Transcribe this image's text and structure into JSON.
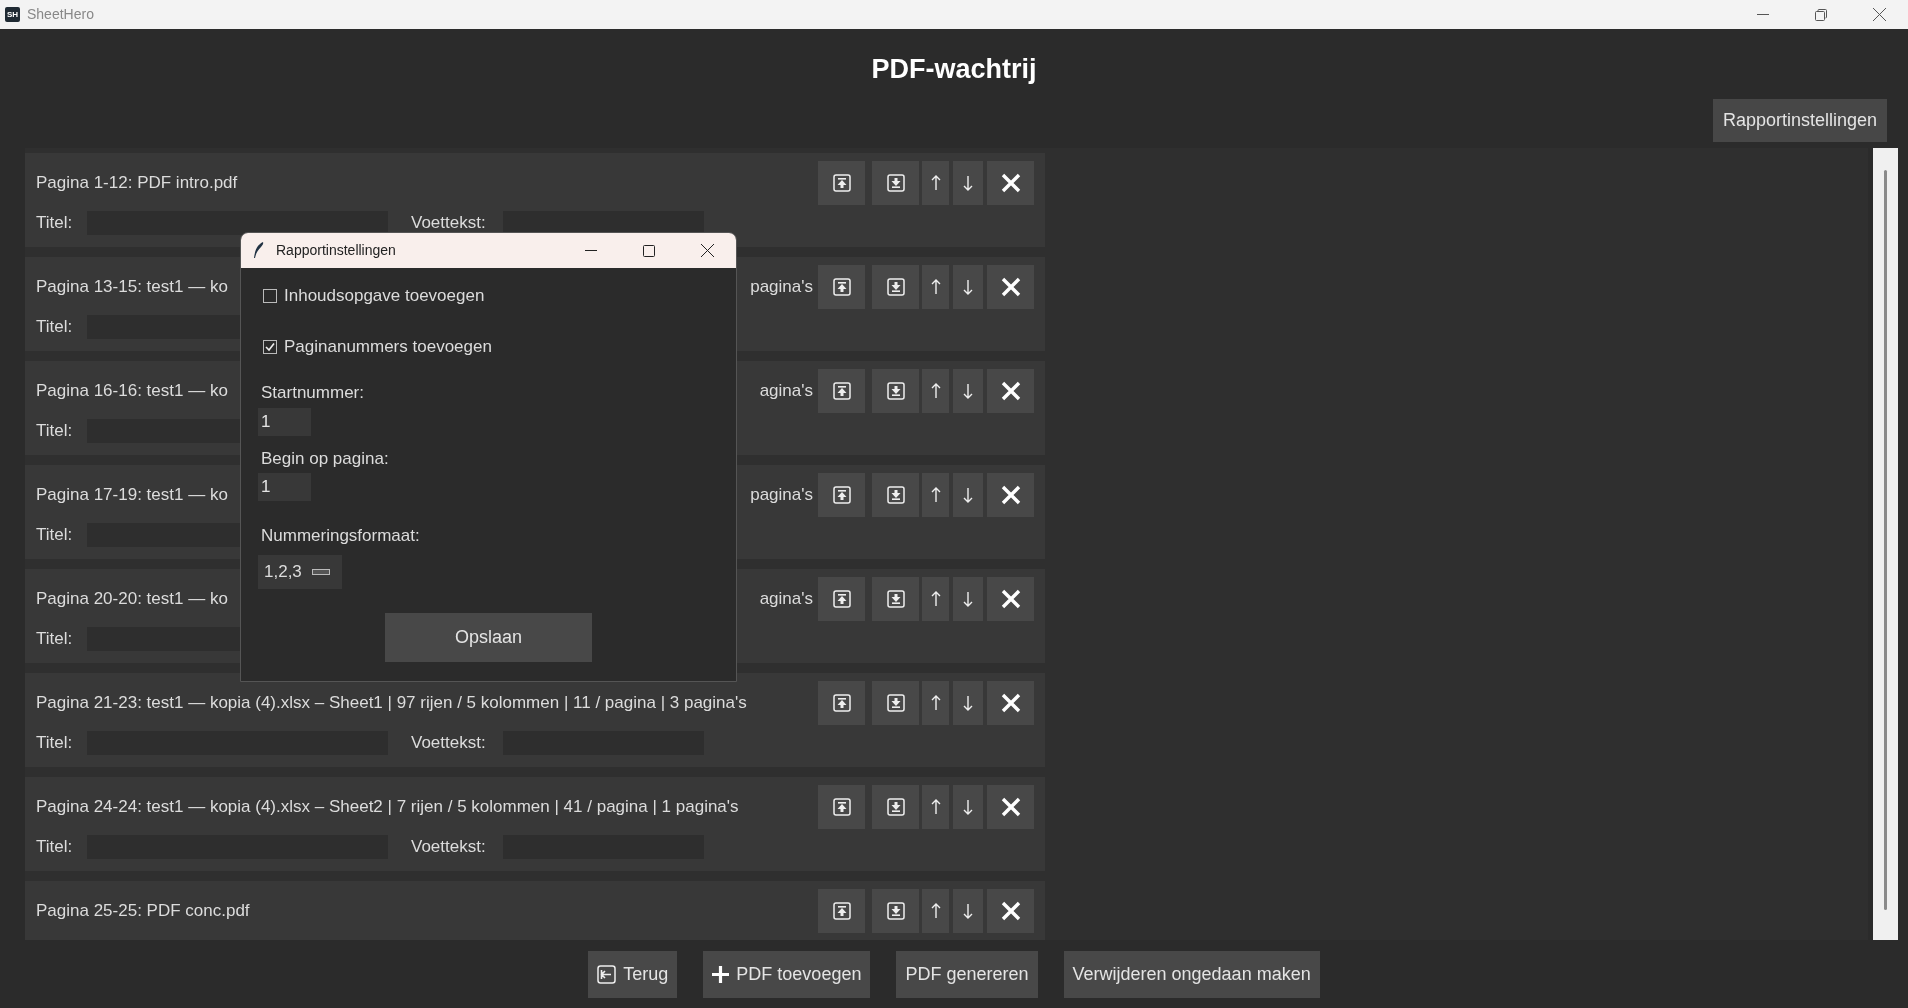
{
  "app": {
    "icon_text": "SH",
    "title": "SheetHero"
  },
  "heading": "PDF-wachtrij",
  "settings_button": "Rapportinstellingen",
  "queue": [
    {
      "label": "Pagina 1-12: PDF intro.pdf",
      "fields": [
        "Titel:",
        "Voettekst:"
      ]
    },
    {
      "label": "Pagina 13-15: test1 — ko",
      "label_end": "pagina's",
      "fields": [
        "Titel:"
      ]
    },
    {
      "label": "Pagina 16-16: test1 — ko",
      "label_end": "agina's",
      "fields": [
        "Titel:"
      ]
    },
    {
      "label": "Pagina 17-19: test1 — ko",
      "label_end": "pagina's",
      "fields": [
        "Titel:"
      ]
    },
    {
      "label": "Pagina 20-20: test1 — ko",
      "label_end": "agina's",
      "fields": [
        "Titel:"
      ]
    },
    {
      "label": "Pagina 21-23: test1 — kopia (4).xlsx – Sheet1 | 97 rijen / 5 kolommen | 11 / pagina | 3 pagina's",
      "fields": [
        "Titel:",
        "Voettekst:"
      ]
    },
    {
      "label": "Pagina 24-24: test1 — kopia (4).xlsx – Sheet2 | 7 rijen / 5 kolommen | 41 / pagina | 1 pagina's",
      "fields": [
        "Titel:",
        "Voettekst:"
      ]
    },
    {
      "label": "Pagina 25-25: PDF conc.pdf"
    }
  ],
  "dialog": {
    "title": "Rapportinstellingen",
    "options": [
      {
        "label": "Inhoudsopgave toevoegen",
        "checked": false
      },
      {
        "label": "Paginanummers toevoegen",
        "checked": true
      }
    ],
    "fields": [
      {
        "label": "Startnummer:",
        "value": "1"
      },
      {
        "label": "Begin op pagina:",
        "value": "1"
      }
    ],
    "format": {
      "label": "Nummeringsformaat:",
      "value": "1,2,3"
    },
    "save_button": "Opslaan"
  },
  "bottom_buttons": [
    {
      "label": "Terug",
      "kind": "back"
    },
    {
      "label": "PDF toevoegen",
      "kind": "add"
    },
    {
      "label": "PDF genereren",
      "kind": "plain"
    },
    {
      "label": "Verwijderen ongedaan maken",
      "kind": "plain"
    }
  ]
}
